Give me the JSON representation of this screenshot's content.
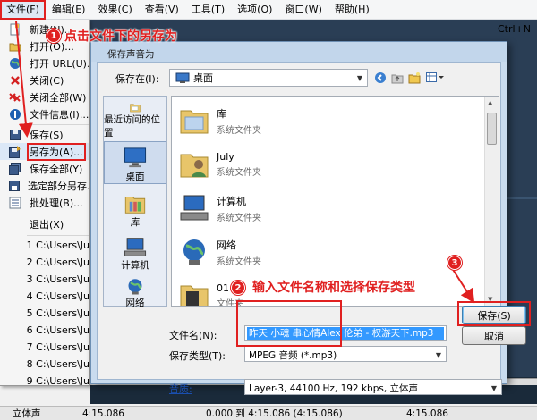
{
  "menubar": {
    "items": [
      {
        "label": "文件(F)"
      },
      {
        "label": "编辑(E)"
      },
      {
        "label": "效果(C)"
      },
      {
        "label": "查看(V)"
      },
      {
        "label": "工具(T)"
      },
      {
        "label": "选项(O)"
      },
      {
        "label": "窗口(W)"
      },
      {
        "label": "帮助(H)"
      }
    ],
    "shortcut_hint": "Ctrl+N"
  },
  "file_menu": {
    "items": [
      {
        "label": "新建(N)...",
        "icon": "new-file-icon"
      },
      {
        "label": "打开(O)...",
        "icon": "folder-open-icon"
      },
      {
        "label": "打开 URL(U)...",
        "icon": "globe-icon"
      },
      {
        "label": "关闭(C)",
        "icon": "close-x-icon"
      },
      {
        "label": "关闭全部(W)",
        "icon": "close-all-icon"
      },
      {
        "label": "文件信息(I)...",
        "icon": "info-icon"
      },
      {
        "label": "保存(S)",
        "icon": "save-disk-icon"
      },
      {
        "label": "另存为(A)...",
        "icon": "save-as-icon"
      },
      {
        "label": "保存全部(Y)",
        "icon": "save-all-icon"
      },
      {
        "label": "选定部分另存...",
        "icon": "save-selection-icon"
      },
      {
        "label": "批处理(B)...",
        "icon": "batch-icon"
      },
      {
        "label": "退出(X)",
        "icon": ""
      }
    ],
    "recent_files": [
      "1 C:\\Users\\Ju",
      "2 C:\\Users\\Ju",
      "3 C:\\Users\\Ju",
      "4 C:\\Users\\Ju",
      "5 C:\\Users\\Ju",
      "6 C:\\Users\\Ju",
      "7 C:\\Users\\Ju",
      "8 C:\\Users\\Ju",
      "9 C:\\Users\\Ju"
    ]
  },
  "dialog": {
    "title": "保存声音为",
    "save_in_label": "保存在(I):",
    "save_in_value": "桌面",
    "places": [
      {
        "label": "最近访问的位置"
      },
      {
        "label": "桌面"
      },
      {
        "label": "库"
      },
      {
        "label": "计算机"
      },
      {
        "label": "网络"
      }
    ],
    "files": [
      {
        "name": "库",
        "type": "系统文件夹"
      },
      {
        "name": "July",
        "type": "系统文件夹"
      },
      {
        "name": "计算机",
        "type": "系统文件夹"
      },
      {
        "name": "网络",
        "type": "系统文件夹"
      },
      {
        "name": "01",
        "type": "文件夹"
      }
    ],
    "filename_label": "文件名(N):",
    "filename_value": "昨天   小魂   串心情Alex   伦弟 - 权游天下.mp3",
    "filetype_label": "保存类型(T):",
    "filetype_value": "MPEG 音频 (*.mp3)",
    "quality_label": "音质:",
    "quality_value": "Layer-3, 44100 Hz, 192 kbps, 立体声",
    "save_button": "保存(S)",
    "cancel_button": "取消"
  },
  "annotations": {
    "step1_number": "1",
    "step1_text": "点击文件下的另存为",
    "step2_number": "2",
    "step2_text": "输入文件名称和选择保存类型",
    "step3_number": "3"
  },
  "statusbar": {
    "channel": "立体声",
    "duration_left": "4:15.086",
    "selection": "0.000 到 4:15.086 (4:15.086)",
    "duration_right": "4:15.086"
  },
  "colors": {
    "annotation_red": "#e02020",
    "dialog_frame": "#c9dbee",
    "selection_blue": "#3399ff"
  }
}
